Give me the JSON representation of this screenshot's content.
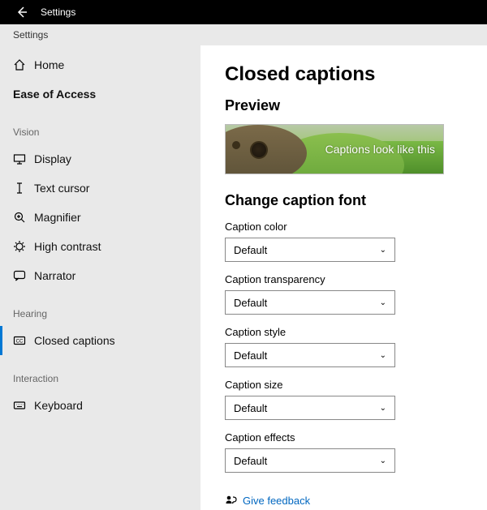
{
  "titlebar": {
    "app_title": "Settings"
  },
  "subheader": {
    "label": "Settings"
  },
  "sidebar": {
    "home": "Home",
    "category": "Ease of Access",
    "sections": {
      "vision": {
        "title": "Vision",
        "items": [
          "Display",
          "Text cursor",
          "Magnifier",
          "High contrast",
          "Narrator"
        ]
      },
      "hearing": {
        "title": "Hearing",
        "items": [
          "Closed captions"
        ]
      },
      "interaction": {
        "title": "Interaction",
        "items": [
          "Keyboard"
        ]
      }
    }
  },
  "content": {
    "page_title": "Closed captions",
    "preview_title": "Preview",
    "preview_caption": "Captions look like this",
    "section_title": "Change caption font",
    "fields": {
      "caption_color": {
        "label": "Caption color",
        "value": "Default"
      },
      "caption_transparency": {
        "label": "Caption transparency",
        "value": "Default"
      },
      "caption_style": {
        "label": "Caption style",
        "value": "Default"
      },
      "caption_size": {
        "label": "Caption size",
        "value": "Default"
      },
      "caption_effects": {
        "label": "Caption effects",
        "value": "Default"
      }
    },
    "feedback": "Give feedback"
  }
}
